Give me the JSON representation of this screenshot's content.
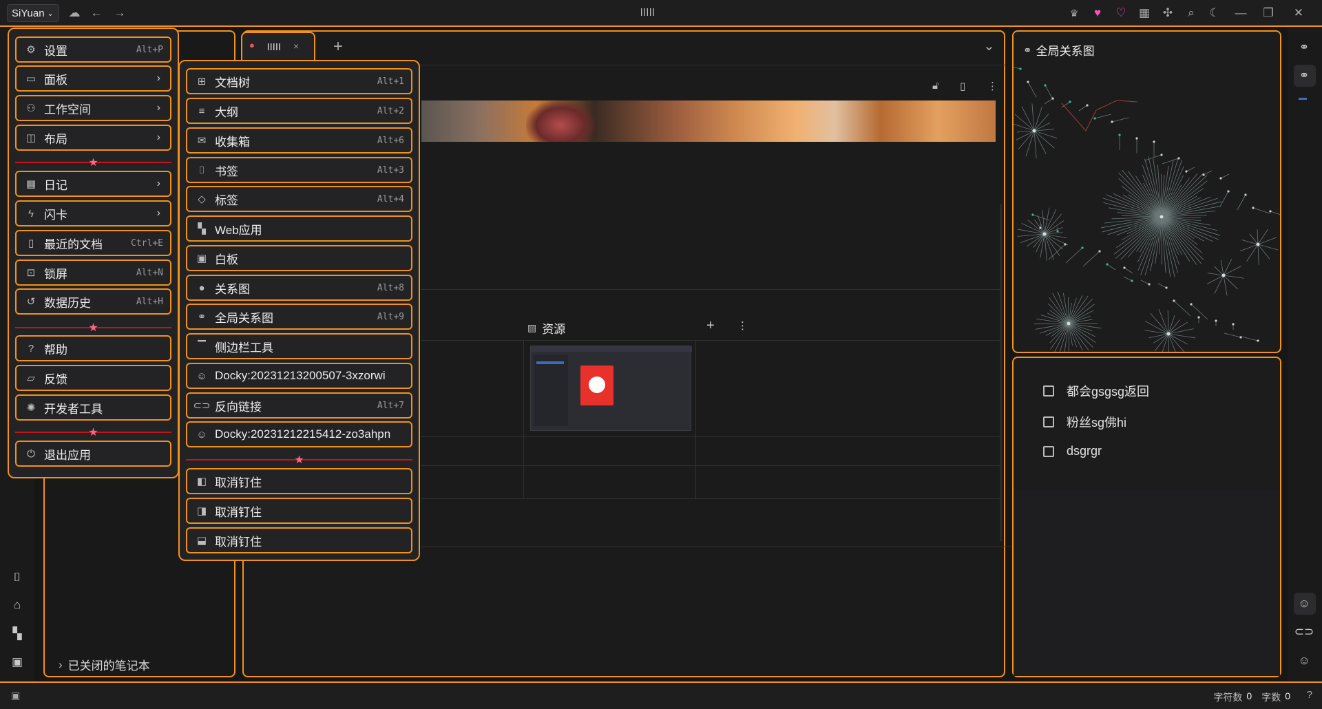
{
  "colors": {
    "accent": "#f0921b",
    "separator": "#c4141b",
    "star": "#ff6680",
    "heart": "#ff4fbf"
  },
  "titlebar": {
    "workspace": "SiYuan",
    "window_title": "lllll",
    "icons": [
      "cloud-icon",
      "back-icon",
      "forward-icon",
      "crown-icon",
      "heart-filled-icon",
      "heart-outline-icon",
      "grid-icon",
      "puzzle-icon",
      "search-icon",
      "moon-icon",
      "minimize-icon",
      "maximize-icon",
      "close-icon"
    ]
  },
  "tab": {
    "label": "lllll",
    "close": "×",
    "add": "+",
    "more": "⌄"
  },
  "notebook": {
    "closed_notebooks": "已关闭的笔记本"
  },
  "editor": {
    "assets_label": "资源"
  },
  "main_menu": [
    {
      "label": "设置",
      "shortcut": "Alt+P",
      "icon": "gear-icon"
    },
    {
      "label": "面板",
      "submenu": true,
      "icon": "panel-icon"
    },
    {
      "label": "工作空间",
      "submenu": true,
      "icon": "workspace-icon"
    },
    {
      "label": "布局",
      "submenu": true,
      "icon": "layout-icon"
    },
    {
      "label": "日记",
      "submenu": true,
      "icon": "calendar-icon"
    },
    {
      "label": "闪卡",
      "submenu": true,
      "icon": "flash-icon"
    },
    {
      "label": "最近的文档",
      "shortcut": "Ctrl+E",
      "icon": "file-icon"
    },
    {
      "label": "锁屏",
      "shortcut": "Alt+N",
      "icon": "lock-icon"
    },
    {
      "label": "数据历史",
      "shortcut": "Alt+H",
      "icon": "history-icon"
    },
    {
      "label": "帮助",
      "icon": "help-icon"
    },
    {
      "label": "反馈",
      "icon": "feedback-icon"
    },
    {
      "label": "开发者工具",
      "icon": "bug-icon"
    },
    {
      "label": "退出应用",
      "icon": "power-icon"
    }
  ],
  "panel_menu": [
    {
      "label": "文档树",
      "shortcut": "Alt+1",
      "icon": "tree-icon"
    },
    {
      "label": "大纲",
      "shortcut": "Alt+2",
      "icon": "outline-icon"
    },
    {
      "label": "收集箱",
      "shortcut": "Alt+6",
      "icon": "inbox-icon"
    },
    {
      "label": "书签",
      "shortcut": "Alt+3",
      "icon": "bookmark-icon"
    },
    {
      "label": "标签",
      "shortcut": "Alt+4",
      "icon": "tag-icon"
    },
    {
      "label": "Web应用",
      "icon": "apps-icon"
    },
    {
      "label": "白板",
      "icon": "whiteboard-icon"
    },
    {
      "label": "关系图",
      "shortcut": "Alt+8",
      "icon": "graph-icon"
    },
    {
      "label": "全局关系图",
      "shortcut": "Alt+9",
      "icon": "global-graph-icon"
    },
    {
      "label": "侧边栏工具",
      "icon": "sidebar-tool-icon"
    },
    {
      "label": "Docky:20231213200507-3xzorwi",
      "icon": "smile-icon"
    },
    {
      "label": "反向链接",
      "shortcut": "Alt+7",
      "icon": "link-icon"
    },
    {
      "label": "Docky:20231212215412-zo3ahpn",
      "icon": "smile-icon"
    },
    {
      "label": "取消钉住",
      "icon": "unpin-left-icon"
    },
    {
      "label": "取消钉住",
      "icon": "unpin-right-icon"
    },
    {
      "label": "取消钉住",
      "icon": "unpin-bottom-icon"
    }
  ],
  "graph": {
    "title": "全局关系图"
  },
  "todos": [
    "都会gsgsg返回",
    "粉丝sg佛hi",
    "dsgrgr"
  ],
  "status": {
    "chars_label": "字符数",
    "chars": "0",
    "words_label": "字数",
    "words": "0"
  }
}
